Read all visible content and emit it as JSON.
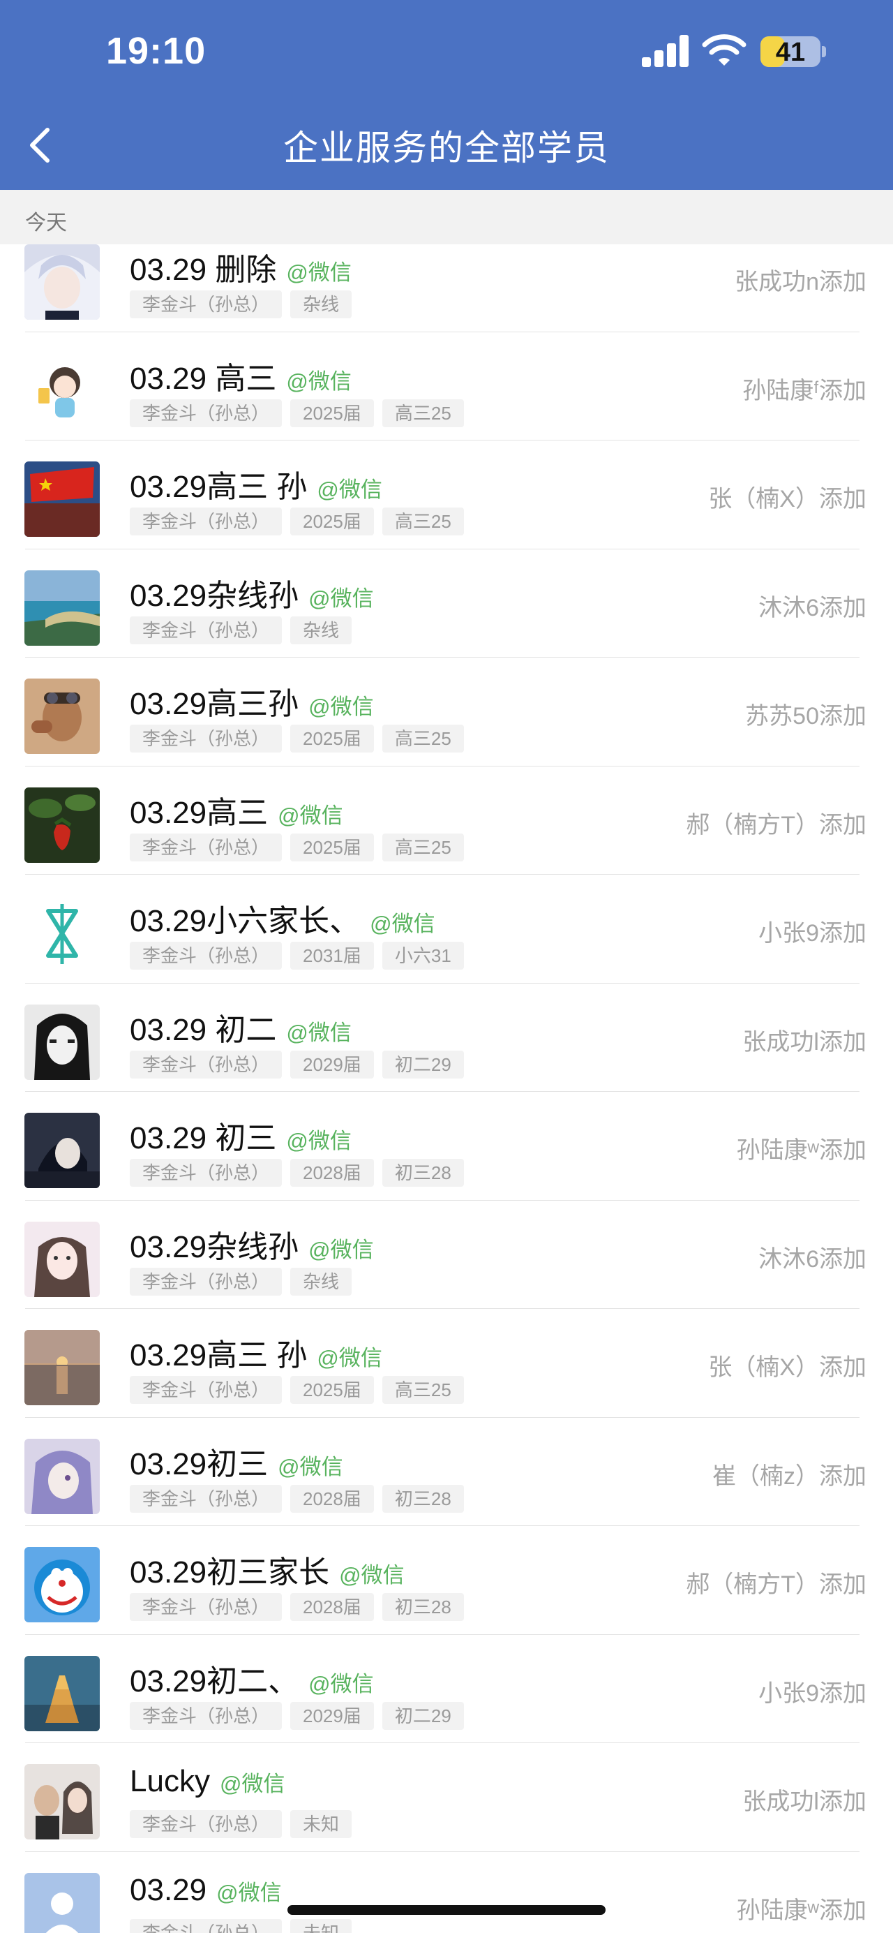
{
  "status_bar": {
    "time": "19:10",
    "battery": "41",
    "battery_level": 0.41
  },
  "nav": {
    "title": "企业服务的全部学员"
  },
  "section": {
    "label": "今天"
  },
  "colors": {
    "header": "#4b72c3",
    "source": "#58b35e",
    "battery": "#f5d547"
  },
  "contacts": [
    {
      "name": "03.29 删除",
      "source": "@微信",
      "tags": [
        "李金斗（孙总）",
        "杂线"
      ],
      "added_by": "张成功n添加",
      "avatar": "anime-white-hair"
    },
    {
      "name": "03.29  高三",
      "source": "@微信",
      "tags": [
        "李金斗（孙总）",
        "2025届",
        "高三25"
      ],
      "added_by": "孙陆康ᶠ添加",
      "avatar": "cartoon-girl-drink"
    },
    {
      "name": "03.29高三  孙",
      "source": "@微信",
      "tags": [
        "李金斗（孙总）",
        "2025届",
        "高三25"
      ],
      "added_by": "张（楠X）添加",
      "avatar": "flag-landscape"
    },
    {
      "name": "03.29杂线孙",
      "source": "@微信",
      "tags": [
        "李金斗（孙总）",
        "杂线"
      ],
      "added_by": "沐沐6添加",
      "avatar": "seaside"
    },
    {
      "name": "03.29高三孙",
      "source": "@微信",
      "tags": [
        "李金斗（孙总）",
        "2025届",
        "高三25"
      ],
      "added_by": "苏苏50添加",
      "avatar": "person-goggles"
    },
    {
      "name": "03.29高三",
      "source": "@微信",
      "tags": [
        "李金斗（孙总）",
        "2025届",
        "高三25"
      ],
      "added_by": "郝（楠方T）添加",
      "avatar": "strawberry"
    },
    {
      "name": "03.29小六家长、",
      "source": "@微信",
      "tags": [
        "李金斗（孙总）",
        "2031届",
        "小六31"
      ],
      "added_by": "小张9添加",
      "avatar": "teal-logo"
    },
    {
      "name": "03.29 初二",
      "source": "@微信",
      "tags": [
        "李金斗（孙总）",
        "2029届",
        "初二29"
      ],
      "added_by": "张成功l添加",
      "avatar": "anime-dark-hair"
    },
    {
      "name": "03.29  初三",
      "source": "@微信",
      "tags": [
        "李金斗（孙总）",
        "2028届",
        "初三28"
      ],
      "added_by": "孙陆康ʷ添加",
      "avatar": "anime-boy-dark"
    },
    {
      "name": "03.29杂线孙",
      "source": "@微信",
      "tags": [
        "李金斗（孙总）",
        "杂线"
      ],
      "added_by": "沐沐6添加",
      "avatar": "girl-selfie"
    },
    {
      "name": "03.29高三 孙",
      "source": "@微信",
      "tags": [
        "李金斗（孙总）",
        "2025届",
        "高三25"
      ],
      "added_by": "张（楠X）添加",
      "avatar": "sunset-sea"
    },
    {
      "name": "03.29初三",
      "source": "@微信",
      "tags": [
        "李金斗（孙总）",
        "2028届",
        "初三28"
      ],
      "added_by": "崔（楠z）添加",
      "avatar": "anime-purple-hair"
    },
    {
      "name": "03.29初三家长",
      "source": "@微信",
      "tags": [
        "李金斗（孙总）",
        "2028届",
        "初三28"
      ],
      "added_by": "郝（楠方T）添加",
      "avatar": "doraemon"
    },
    {
      "name": "03.29初二、",
      "source": "@微信",
      "tags": [
        "李金斗（孙总）",
        "2029届",
        "初二29"
      ],
      "added_by": "小张9添加",
      "avatar": "golden-pagoda"
    },
    {
      "name": "Lucky",
      "source": "@微信",
      "tags": [
        "李金斗（孙总）",
        "未知"
      ],
      "added_by": "张成功l添加",
      "avatar": "couple-photo"
    },
    {
      "name": "03.29",
      "source": "@微信",
      "tags": [
        "李金斗（孙总）",
        "未知"
      ],
      "added_by": "孙陆康ʷ添加",
      "avatar": "default-person"
    }
  ]
}
